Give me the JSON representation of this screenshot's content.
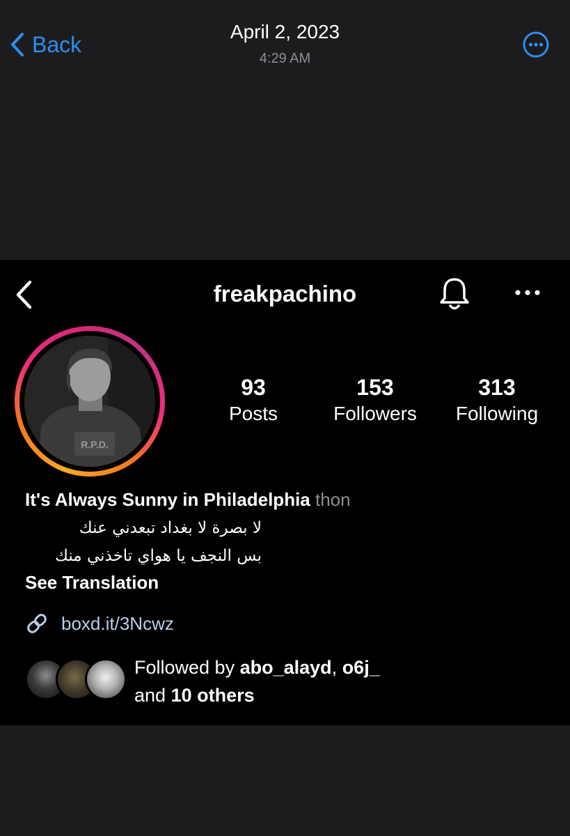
{
  "viewer": {
    "back_label": "Back",
    "date": "April 2, 2023",
    "time": "4:29 AM",
    "accent_color": "#2e8ef0"
  },
  "profile": {
    "username": "freakpachino",
    "stats": {
      "posts": {
        "value": "93",
        "label": "Posts"
      },
      "followers": {
        "value": "153",
        "label": "Followers"
      },
      "following": {
        "value": "313",
        "label": "Following"
      }
    },
    "bio": {
      "name": "It's Always Sunny in Philadelphia",
      "name_suffix": "thon",
      "line1": "لا بصرة لا بغداد تبعدني عنك",
      "line2": "بس النجف يا هواي تاخذني منك",
      "see_translation": "See Translation"
    },
    "link": "boxd.it/3Ncwz",
    "followed_by": {
      "prefix": "Followed by",
      "user1": "abo_alayd",
      "separator": ",",
      "user2": "o6j_",
      "and_text": "and",
      "others": "10 others"
    },
    "ring_colors": [
      "#f9a826",
      "#ee2a7b",
      "#c13584"
    ]
  },
  "icons": {
    "viewer_back": "chevron-left-icon",
    "viewer_more": "more-circle-icon",
    "profile_back": "chevron-left-icon",
    "notifications": "bell-icon",
    "profile_more": "more-horizontal-icon",
    "link": "link-icon"
  }
}
